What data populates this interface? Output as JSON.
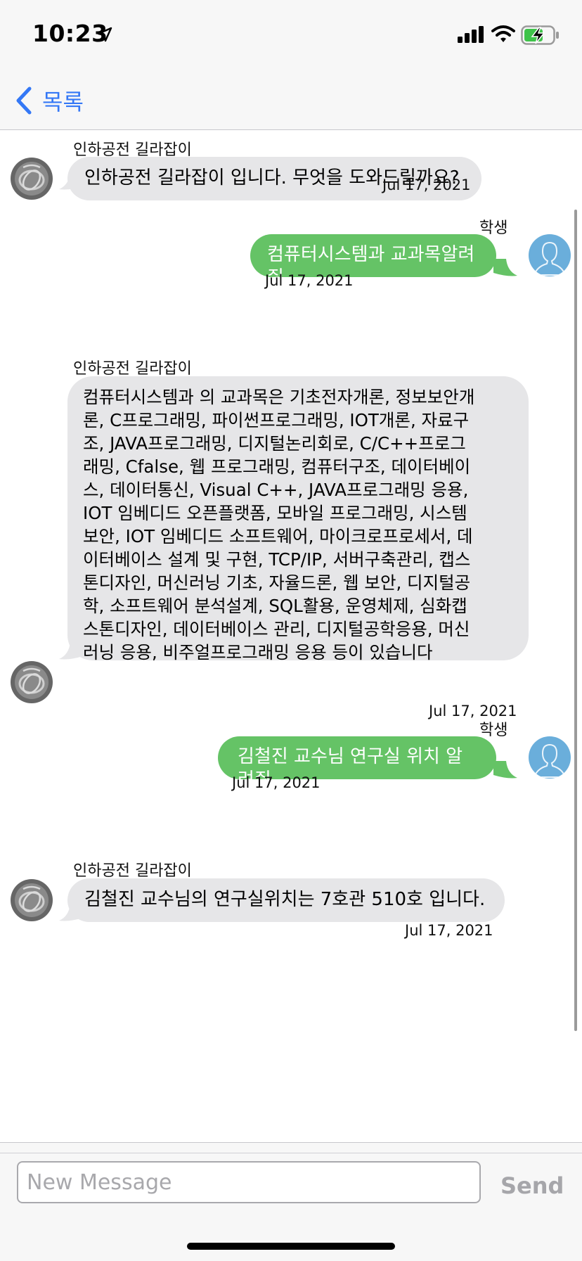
{
  "status_bar": {
    "time": "10:23"
  },
  "nav": {
    "back_label": "목록"
  },
  "messages": [
    {
      "direction": "in",
      "sender": "인하공전 길라잡이",
      "text": "인하공전 길라잡이 입니다. 무엇을 도와드릴까요?",
      "timestamp": "Jul 17, 2021"
    },
    {
      "direction": "out",
      "sender": "학생",
      "text": "컴퓨터시스템과 교과목알려줘",
      "timestamp": "Jul 17, 2021"
    },
    {
      "direction": "in",
      "sender": "인하공전 길라잡이",
      "lines": [
        "컴퓨터시스템과 의 교과목은 기초전자개론, 정보보안개",
        "론, C프로그래밍, 파이썬프로그래밍, IOT개론, 자료구",
        "조, JAVA프로그래밍, 디지털논리회로, C/C++프로그",
        "래밍, Cfalse, 웹 프로그래밍, 컴퓨터구조, 데이터베이",
        "스, 데이터통신, Visual C++, JAVA프로그래밍 응용,",
        "IOT 임베디드 오픈플랫폼, 모바일 프로그래밍, 시스템",
        "보안, IOT 임베디드 소프트웨어, 마이크로프로세서, 데",
        "이터베이스 설계 및 구현, TCP/IP, 서버구축관리, 캡스",
        "톤디자인, 머신러닝 기초, 자율드론, 웹 보안, 디지털공",
        "학, 소프트웨어 분석설계, SQL활용, 운영체제, 심화캡",
        "스톤디자인, 데이터베이스 관리, 디지털공학응용, 머신",
        "러닝 응용, 비주얼프로그래밍 응용 등이 있습니다"
      ],
      "timestamp": "Jul 17, 2021"
    },
    {
      "direction": "out",
      "sender": "학생",
      "text": "김철진 교수님 연구실 위치 알려줘",
      "timestamp": "Jul 17, 2021"
    },
    {
      "direction": "in",
      "sender": "인하공전 길라잡이",
      "text": "김철진 교수님의 연구실위치는 7호관 510호 입니다.",
      "timestamp": "Jul 17, 2021"
    }
  ],
  "composer": {
    "placeholder": "New Message",
    "value": "",
    "send_label": "Send"
  },
  "colors": {
    "accent": "#3478f6",
    "incoming_bubble": "#e6e6e8",
    "outgoing_bubble": "#65c366",
    "user_avatar": "#6aaedb"
  }
}
